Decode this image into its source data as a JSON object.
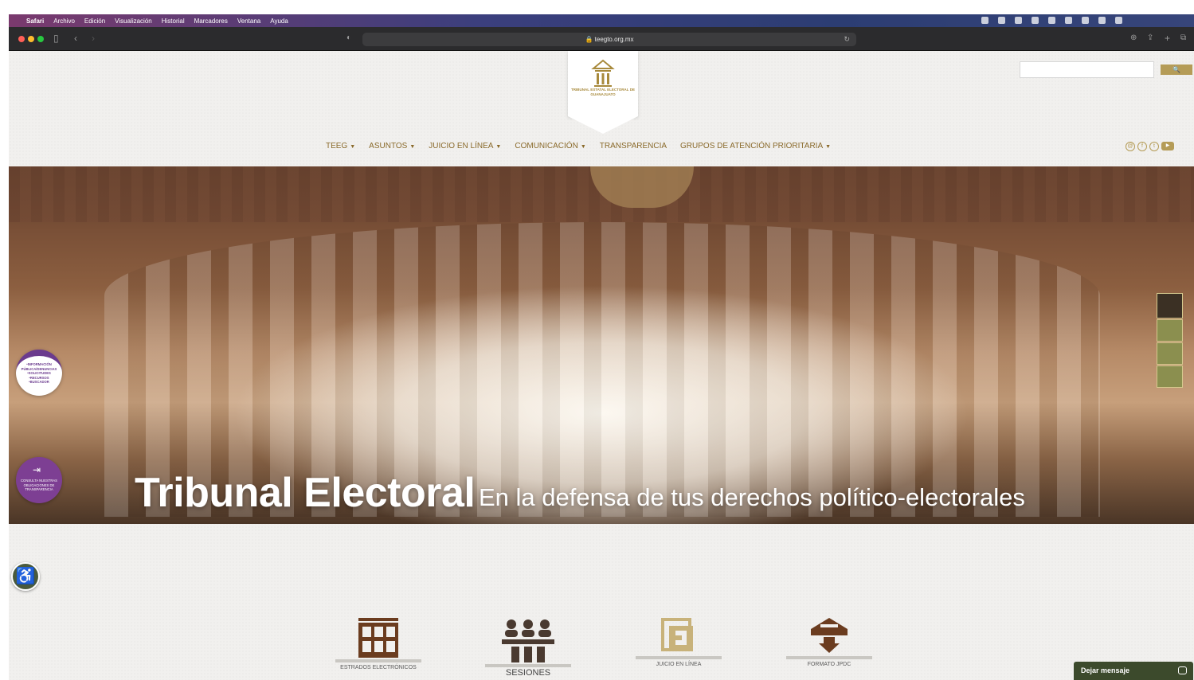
{
  "menubar": {
    "items": [
      "Safari",
      "Archivo",
      "Edición",
      "Visualización",
      "Historial",
      "Marcadores",
      "Ventana",
      "Ayuda"
    ]
  },
  "browser": {
    "url": "teegto.org.mx"
  },
  "site": {
    "logo_text": "TRIBUNAL ESTATAL ELECTORAL DE GUANAJUATO",
    "search": {
      "button_label": "🔍",
      "value": ""
    },
    "nav": [
      {
        "label": "TEEG",
        "dropdown": true
      },
      {
        "label": "ASUNTOS",
        "dropdown": true
      },
      {
        "label": "JUICIO EN LÍNEA",
        "dropdown": true
      },
      {
        "label": "COMUNICACIÓN",
        "dropdown": true
      },
      {
        "label": "TRANSPARENCIA",
        "dropdown": false
      },
      {
        "label": "GRUPOS DE ATENCIÓN PRIORITARIA",
        "dropdown": true
      }
    ],
    "social_icons": [
      "email-icon",
      "facebook-icon",
      "twitter-icon",
      "youtube-icon"
    ],
    "hero": {
      "title": "Tribunal Electoral",
      "subtitle": "En la defensa de tus derechos político-electorales"
    },
    "info_badge": "•INFORMACIÓN PÚBLICA/DENUNCIAS •SOLICITUDES •RECURSOS •BUSCADOR",
    "transparency_badge": "CONSULTA NUESTRAS OBLIGACIONES DE TRANSPARENCIA",
    "quick_links": [
      {
        "label": "ESTRADOS ELECTRÓNICOS",
        "icon": "grid-building-icon"
      },
      {
        "label": "SESIONES",
        "icon": "people-session-icon"
      },
      {
        "label": "JUICIO EN LÍNEA",
        "icon": "document-j-icon"
      },
      {
        "label": "FORMATO JPDC",
        "icon": "ballot-box-icon"
      }
    ],
    "chat": {
      "label": "Dejar mensaje"
    },
    "colors": {
      "gold": "#b59c57",
      "brown": "#6b3c1f",
      "olive": "#3c4a2c",
      "purple": "#6b3b8e"
    }
  }
}
